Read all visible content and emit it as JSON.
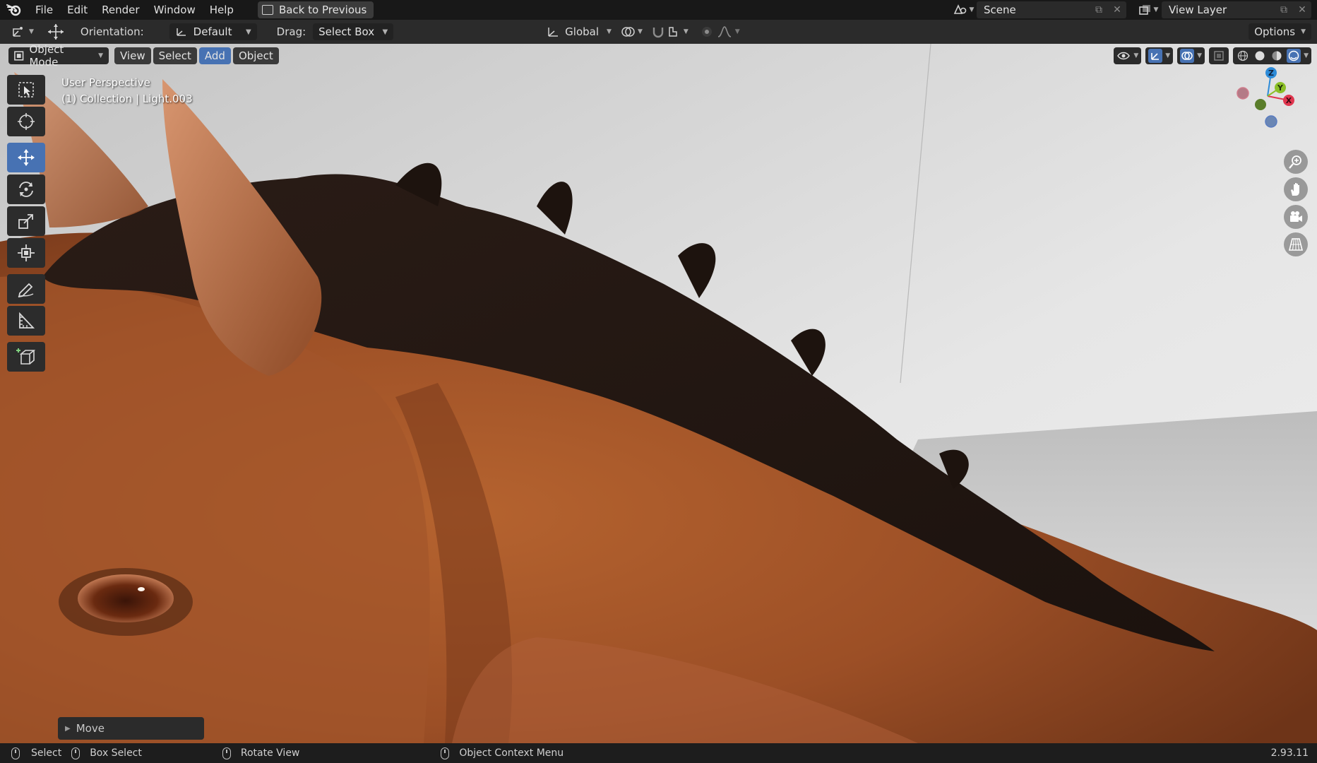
{
  "menubar": {
    "items": [
      "File",
      "Edit",
      "Render",
      "Window",
      "Help"
    ],
    "back_button": "Back to Previous",
    "scene_name": "Scene",
    "view_layer": "View Layer"
  },
  "toolbar": {
    "orientation_label": "Orientation:",
    "orientation_value": "Default",
    "drag_label": "Drag:",
    "drag_value": "Select Box",
    "transform_space": "Global",
    "options_label": "Options"
  },
  "viewport": {
    "mode": "Object Mode",
    "menus": [
      {
        "label": "View",
        "active": false
      },
      {
        "label": "Select",
        "active": false
      },
      {
        "label": "Add",
        "active": true
      },
      {
        "label": "Object",
        "active": false
      }
    ],
    "overlay_line1": "User Perspective",
    "overlay_line2": "(1) Collection | Light.003",
    "gizmo_axes": {
      "z": "Z",
      "y": "Y",
      "x": "X"
    },
    "last_operator": "Move"
  },
  "tools": [
    {
      "name": "select-box-tool",
      "active": false
    },
    {
      "name": "cursor-tool",
      "active": false
    },
    {
      "name": "move-tool",
      "active": true
    },
    {
      "name": "rotate-tool",
      "active": false
    },
    {
      "name": "scale-tool",
      "active": false
    },
    {
      "name": "transform-tool",
      "active": false
    },
    {
      "name": "annotate-tool",
      "active": false
    },
    {
      "name": "measure-tool",
      "active": false
    },
    {
      "name": "add-cube-tool",
      "active": false
    }
  ],
  "statusbar": {
    "select": "Select",
    "box_select": "Box Select",
    "rotate_view": "Rotate View",
    "context_menu": "Object Context Menu",
    "version": "2.93.11"
  },
  "colors": {
    "accent": "#4772b3",
    "axis_x": "#e0364f",
    "axis_y": "#8bbf27",
    "axis_z": "#2d8bd8",
    "horse_coat": "#a5532a",
    "mane": "#2a1a14"
  }
}
